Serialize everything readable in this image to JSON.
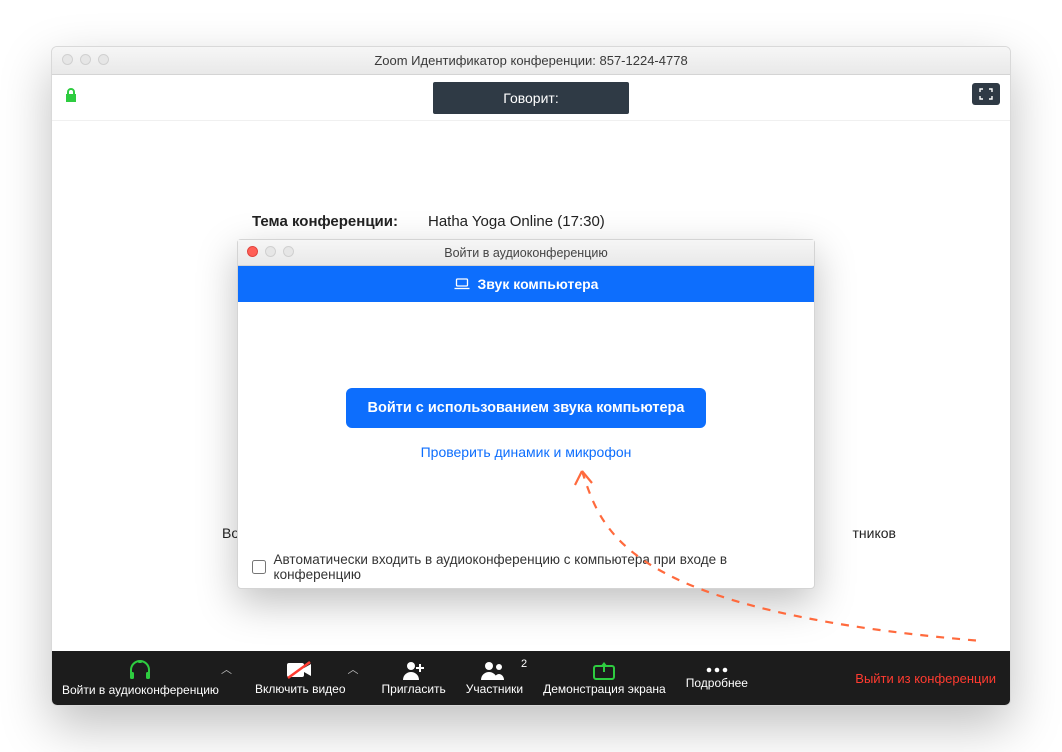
{
  "window": {
    "title": "Zoom Идентификатор конференции: 857-1224-4778"
  },
  "topbar": {
    "speaking_label": "Говорит:"
  },
  "meeting": {
    "topic_label": "Тема конференции:",
    "topic_value": "Hatha Yoga Online (17:30)",
    "under_left": "Вой",
    "under_right": "тников"
  },
  "audio_modal": {
    "title": "Войти в аудиоконференцию",
    "tab_label": "Звук компьютера",
    "primary_button": "Войти с использованием звука компьютера",
    "test_link": "Проверить динамик и микрофон",
    "auto_checkbox_label": "Автоматически входить в аудиоконференцию с компьютера при входе в конференцию"
  },
  "toolbar": {
    "items": [
      {
        "label": "Войти в аудиоконференцию",
        "name": "join-audio-button",
        "icon": "headphones",
        "accent": "#2ecc40",
        "caret": true
      },
      {
        "label": "Включить видео",
        "name": "start-video-button",
        "icon": "video-off",
        "caret": true
      },
      {
        "label": "Пригласить",
        "name": "invite-button",
        "icon": "invite"
      },
      {
        "label": "Участники",
        "name": "participants-button",
        "icon": "participants",
        "count": "2"
      },
      {
        "label": "Демонстрация экрана",
        "name": "share-screen-button",
        "icon": "share",
        "accent": "#2ecc40"
      },
      {
        "label": "Подробнее",
        "name": "more-button",
        "icon": "more"
      }
    ],
    "leave_label": "Выйти из конференции"
  }
}
